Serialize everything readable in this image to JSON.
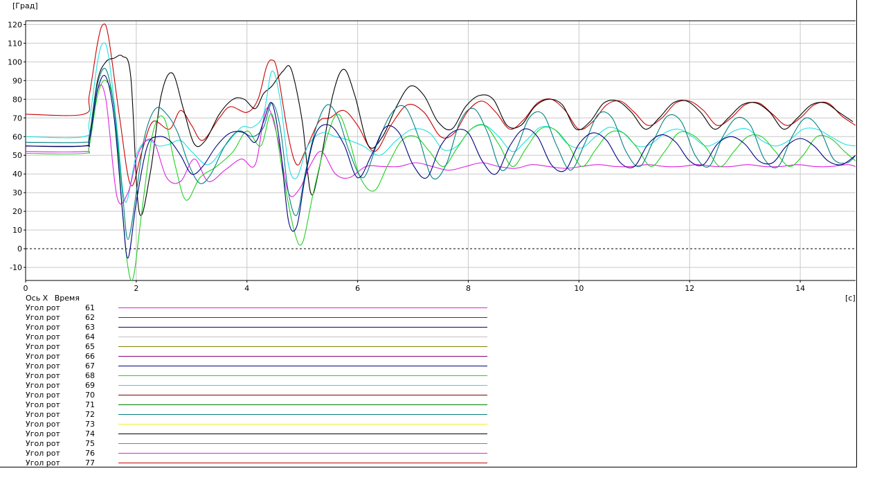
{
  "axes": {
    "y_unit": "[Град]",
    "x_unit": "[c]",
    "y_ticks": [
      "120",
      "110",
      "100",
      "90",
      "80",
      "70",
      "60",
      "50",
      "40",
      "30",
      "20",
      "10",
      "0",
      "-10"
    ],
    "x_ticks": [
      "0",
      "2",
      "4",
      "6",
      "8",
      "10",
      "12",
      "14"
    ]
  },
  "legend": {
    "axis_label": "Ось X",
    "axis_name": "Время",
    "items": [
      {
        "name": "Угол рот",
        "id": "61",
        "color": "#e020e0"
      },
      {
        "name": "Угол рот",
        "id": "62",
        "color": "#c80000"
      },
      {
        "name": "Угол рот",
        "id": "63",
        "color": "#000080"
      },
      {
        "name": "Угол рот",
        "id": "64",
        "color": "#c0c0c0"
      },
      {
        "name": "Угол рот",
        "id": "65",
        "color": "#808000"
      },
      {
        "name": "Угол рот",
        "id": "66",
        "color": "#800080"
      },
      {
        "name": "Угол рот",
        "id": "67",
        "color": "#000080"
      },
      {
        "name": "Угол рот",
        "id": "68",
        "color": "#20d020"
      },
      {
        "name": "Угол рот",
        "id": "69",
        "color": "#20e0e0"
      },
      {
        "name": "Угол рот",
        "id": "70",
        "color": "#800000"
      },
      {
        "name": "Угол рот",
        "id": "71",
        "color": "#008000"
      },
      {
        "name": "Угол рот",
        "id": "72",
        "color": "#008080"
      },
      {
        "name": "Угол рот",
        "id": "73",
        "color": "#f0f020"
      },
      {
        "name": "Угол рот",
        "id": "74",
        "color": "#000000"
      },
      {
        "name": "Угол рот",
        "id": "75",
        "color": "#808080"
      },
      {
        "name": "Угол рот",
        "id": "76",
        "color": "#e020e0"
      },
      {
        "name": "Угол рот",
        "id": "77",
        "color": "#c80000"
      }
    ]
  },
  "chart_data": {
    "type": "line",
    "title": "",
    "xlabel": "[c]",
    "ylabel": "[Град]",
    "xlim": [
      0,
      15
    ],
    "ylim": [
      -17,
      122
    ],
    "grid": true,
    "zero_line": "dashed",
    "series": [
      {
        "name": "Угол рот 62",
        "color": "#c80000",
        "x": [
          0,
          1.05,
          1.15,
          1.3,
          1.4,
          1.5,
          1.7,
          1.9,
          2.1,
          2.3,
          2.6,
          2.8,
          3.0,
          3.2,
          3.5,
          3.7,
          4.0,
          4.2,
          4.35,
          4.45,
          4.55,
          4.75,
          4.9,
          5.05,
          5.3,
          5.5,
          5.75,
          6.0,
          6.3,
          6.6,
          6.9,
          7.2,
          7.5,
          7.75,
          8.0,
          8.25,
          8.5,
          8.75,
          9.0,
          9.25,
          9.5,
          9.75,
          10.0,
          10.25,
          10.5,
          10.75,
          11.0,
          11.25,
          11.5,
          11.75,
          12.0,
          12.25,
          12.5,
          12.75,
          13.0,
          13.25,
          13.5,
          13.75,
          14.0,
          14.25,
          14.5,
          14.75,
          15.0
        ],
        "y": [
          72,
          72,
          82,
          110,
          120,
          113,
          70,
          34,
          52,
          68,
          64,
          74,
          66,
          58,
          70,
          76,
          73,
          80,
          97,
          101,
          95,
          60,
          45,
          52,
          68,
          70,
          74,
          66,
          52,
          66,
          77,
          73,
          60,
          62,
          74,
          79,
          73,
          64,
          69,
          78,
          80,
          74,
          64,
          68,
          77,
          79,
          73,
          66,
          70,
          78,
          79,
          74,
          66,
          70,
          77,
          78,
          72,
          66,
          70,
          77,
          78,
          71,
          66
        ]
      },
      {
        "name": "Угол рот 74",
        "color": "#000000",
        "x": [
          0,
          1.05,
          1.15,
          1.3,
          1.45,
          1.6,
          1.75,
          1.9,
          2.05,
          2.25,
          2.45,
          2.65,
          2.85,
          3.05,
          3.25,
          3.5,
          3.75,
          3.95,
          4.15,
          4.3,
          4.45,
          4.65,
          4.8,
          5.0,
          5.15,
          5.3,
          5.55,
          5.75,
          5.95,
          6.2,
          6.45,
          6.7,
          6.95,
          7.2,
          7.45,
          7.7,
          7.95,
          8.2,
          8.45,
          8.7,
          8.95,
          9.2,
          9.45,
          9.7,
          9.95,
          10.2,
          10.45,
          10.7,
          10.95,
          11.2,
          11.45,
          11.7,
          11.95,
          12.2,
          12.45,
          12.7,
          12.95,
          13.2,
          13.45,
          13.7,
          13.95,
          14.2,
          14.45,
          14.7,
          14.95
        ],
        "y": [
          55,
          55,
          60,
          90,
          100,
          102,
          103,
          92,
          20,
          40,
          82,
          94,
          75,
          56,
          58,
          72,
          80,
          80,
          75,
          83,
          87,
          95,
          96,
          68,
          30,
          42,
          82,
          96,
          82,
          55,
          60,
          76,
          87,
          82,
          68,
          64,
          76,
          82,
          80,
          66,
          66,
          76,
          80,
          77,
          64,
          68,
          78,
          79,
          73,
          64,
          70,
          78,
          79,
          73,
          64,
          70,
          77,
          78,
          73,
          64,
          70,
          77,
          78,
          73,
          68
        ]
      },
      {
        "name": "Угол рот 69",
        "color": "#20e0e0",
        "x": [
          0,
          1.05,
          1.15,
          1.3,
          1.4,
          1.5,
          1.65,
          1.8,
          2.0,
          2.2,
          2.4,
          2.6,
          2.8,
          3.0,
          3.3,
          3.6,
          3.9,
          4.1,
          4.3,
          4.45,
          4.6,
          4.75,
          4.9,
          5.1,
          5.35,
          5.6,
          5.85,
          6.1,
          6.4,
          6.7,
          7.0,
          7.3,
          7.55,
          7.8,
          8.05,
          8.3,
          8.55,
          8.8,
          9.05,
          9.3,
          9.55,
          9.8,
          10.05,
          10.3,
          10.55,
          10.8,
          11.05,
          11.3,
          11.55,
          11.8,
          12.05,
          12.3,
          12.55,
          12.8,
          13.05,
          13.3,
          13.55,
          13.8,
          14.05,
          14.3,
          14.55,
          14.8,
          15.0
        ],
        "y": [
          60,
          60,
          68,
          100,
          110,
          103,
          65,
          25,
          50,
          58,
          55,
          56,
          58,
          52,
          45,
          55,
          65,
          65,
          72,
          95,
          80,
          45,
          38,
          55,
          62,
          60,
          58,
          55,
          50,
          58,
          64,
          62,
          53,
          55,
          64,
          66,
          60,
          52,
          58,
          65,
          64,
          56,
          54,
          60,
          65,
          62,
          55,
          56,
          62,
          64,
          60,
          55,
          58,
          63,
          64,
          58,
          55,
          58,
          64,
          64,
          60,
          56,
          55
        ]
      },
      {
        "name": "Угол рот 61",
        "color": "#e020e0",
        "x": [
          0,
          1.05,
          1.15,
          1.3,
          1.45,
          1.65,
          1.85,
          2.05,
          2.3,
          2.55,
          2.8,
          3.05,
          3.3,
          3.6,
          3.9,
          4.15,
          4.35,
          4.55,
          4.75,
          4.95,
          5.15,
          5.35,
          5.6,
          5.85,
          6.15,
          6.45,
          6.75,
          7.05,
          7.35,
          7.65,
          7.95,
          8.25,
          8.55,
          8.85,
          9.15,
          9.45,
          9.75,
          10.05,
          10.35,
          10.65,
          10.95,
          11.25,
          11.55,
          11.85,
          12.15,
          12.45,
          12.75,
          13.05,
          13.35,
          13.65,
          13.95,
          14.25,
          14.55,
          14.85,
          15.0
        ],
        "y": [
          52,
          52,
          55,
          85,
          80,
          28,
          30,
          52,
          58,
          38,
          36,
          48,
          36,
          42,
          48,
          45,
          75,
          60,
          30,
          32,
          45,
          52,
          40,
          38,
          44,
          44,
          44,
          46,
          44,
          42,
          44,
          46,
          44,
          43,
          45,
          44,
          43,
          44,
          45,
          44,
          44,
          45,
          44,
          44,
          45,
          44,
          44,
          45,
          44,
          44,
          45,
          44,
          44,
          45,
          44
        ]
      },
      {
        "name": "Угол рот 68",
        "color": "#20d020",
        "x": [
          0,
          1.05,
          1.15,
          1.3,
          1.45,
          1.6,
          1.75,
          1.85,
          1.95,
          2.1,
          2.3,
          2.5,
          2.7,
          2.9,
          3.15,
          3.45,
          3.75,
          4.0,
          4.25,
          4.45,
          4.65,
          4.85,
          5.0,
          5.2,
          5.45,
          5.65,
          5.85,
          6.05,
          6.3,
          6.55,
          6.8,
          7.05,
          7.3,
          7.55,
          7.8,
          8.05,
          8.3,
          8.55,
          8.8,
          9.05,
          9.3,
          9.55,
          9.8,
          10.05,
          10.3,
          10.55,
          10.8,
          11.05,
          11.3,
          11.55,
          11.8,
          12.05,
          12.3,
          12.55,
          12.8,
          13.05,
          13.3,
          13.55,
          13.8,
          14.05,
          14.3,
          14.55,
          14.8,
          15.0
        ],
        "y": [
          51,
          51,
          55,
          82,
          90,
          75,
          20,
          -10,
          -15,
          20,
          62,
          70,
          45,
          26,
          38,
          44,
          52,
          63,
          55,
          72,
          40,
          10,
          3,
          30,
          60,
          72,
          58,
          38,
          31,
          45,
          58,
          60,
          52,
          44,
          54,
          64,
          66,
          56,
          44,
          54,
          64,
          64,
          56,
          44,
          53,
          62,
          62,
          54,
          44,
          52,
          62,
          61,
          54,
          44,
          52,
          60,
          60,
          52,
          44,
          50,
          60,
          59,
          52,
          47
        ]
      },
      {
        "name": "Угол рот 72",
        "color": "#008080",
        "x": [
          0,
          1.05,
          1.15,
          1.3,
          1.45,
          1.6,
          1.75,
          1.85,
          2.0,
          2.15,
          2.35,
          2.55,
          2.75,
          2.95,
          3.15,
          3.35,
          3.6,
          3.85,
          4.1,
          4.3,
          4.45,
          4.6,
          4.75,
          4.9,
          5.05,
          5.25,
          5.45,
          5.65,
          5.85,
          6.1,
          6.35,
          6.6,
          6.85,
          7.1,
          7.35,
          7.6,
          7.85,
          8.1,
          8.35,
          8.6,
          8.85,
          9.1,
          9.35,
          9.6,
          9.85,
          10.1,
          10.35,
          10.6,
          10.85,
          11.1,
          11.35,
          11.6,
          11.85,
          12.1,
          12.35,
          12.6,
          12.85,
          13.1,
          13.35,
          13.6,
          13.85,
          14.1,
          14.35,
          14.6,
          14.85,
          15.0
        ],
        "y": [
          57,
          57,
          60,
          88,
          96,
          75,
          30,
          5,
          30,
          60,
          75,
          72,
          62,
          45,
          35,
          40,
          55,
          63,
          60,
          65,
          78,
          65,
          30,
          18,
          40,
          65,
          77,
          70,
          52,
          38,
          56,
          72,
          76,
          60,
          38,
          45,
          68,
          75,
          62,
          42,
          52,
          70,
          72,
          55,
          42,
          56,
          72,
          70,
          52,
          44,
          58,
          71,
          68,
          50,
          44,
          60,
          70,
          66,
          48,
          44,
          60,
          70,
          64,
          48,
          46,
          50
        ]
      },
      {
        "name": "Угол рот 63",
        "color": "#000080",
        "x": [
          0,
          1.05,
          1.15,
          1.3,
          1.45,
          1.6,
          1.75,
          1.85,
          2.0,
          2.2,
          2.4,
          2.6,
          2.8,
          3.0,
          3.2,
          3.45,
          3.7,
          3.95,
          4.15,
          4.3,
          4.45,
          4.6,
          4.75,
          4.9,
          5.05,
          5.25,
          5.5,
          5.75,
          6.0,
          6.25,
          6.5,
          6.75,
          7.0,
          7.25,
          7.5,
          7.75,
          8.0,
          8.25,
          8.5,
          8.75,
          9.0,
          9.25,
          9.5,
          9.75,
          10.0,
          10.25,
          10.5,
          10.75,
          11.0,
          11.25,
          11.5,
          11.75,
          12.0,
          12.25,
          12.5,
          12.75,
          13.0,
          13.25,
          13.5,
          13.75,
          14.0,
          14.25,
          14.5,
          14.75,
          15.0
        ],
        "y": [
          55,
          55,
          58,
          85,
          92,
          70,
          20,
          -5,
          25,
          55,
          60,
          58,
          50,
          40,
          44,
          55,
          62,
          62,
          57,
          68,
          78,
          55,
          15,
          12,
          38,
          62,
          66,
          56,
          38,
          50,
          65,
          62,
          45,
          38,
          55,
          63,
          62,
          47,
          40,
          55,
          64,
          60,
          45,
          42,
          56,
          62,
          58,
          46,
          44,
          56,
          61,
          57,
          47,
          45,
          56,
          60,
          56,
          47,
          46,
          55,
          59,
          55,
          47,
          45,
          50
        ]
      }
    ]
  }
}
